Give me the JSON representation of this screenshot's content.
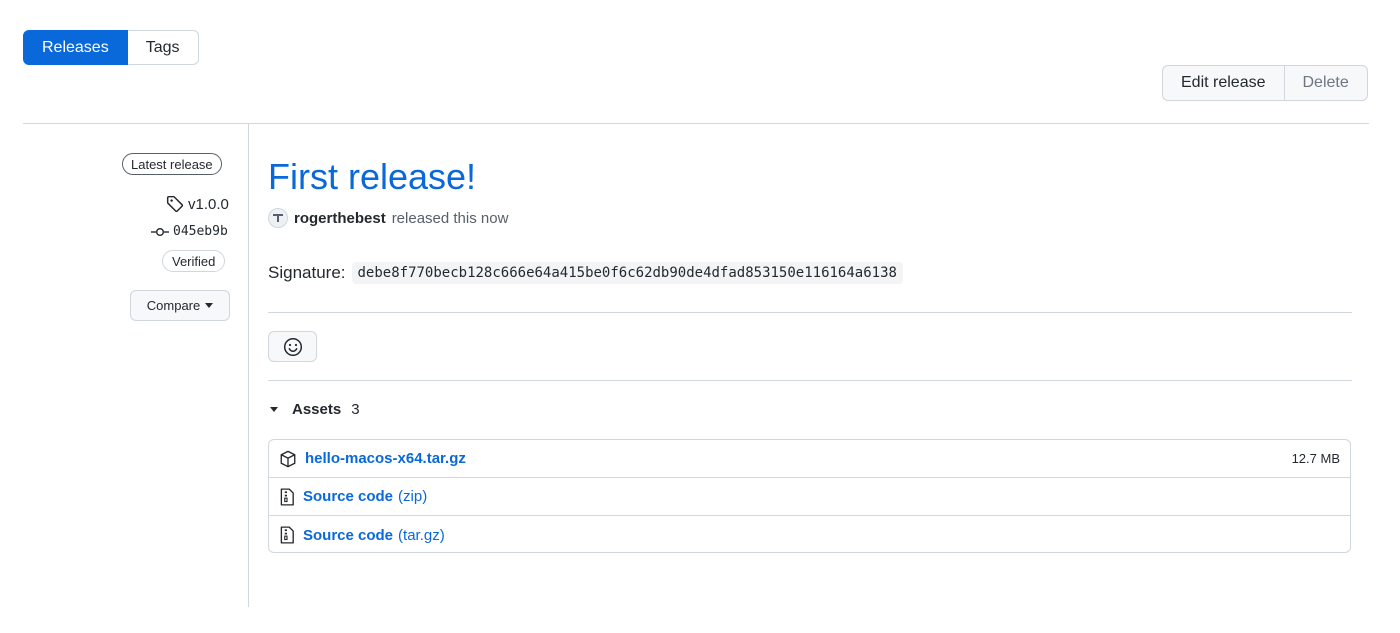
{
  "tabs": [
    {
      "label": "Releases",
      "active": true
    },
    {
      "label": "Tags",
      "active": false
    }
  ],
  "actions": {
    "edit_label": "Edit release",
    "delete_label": "Delete"
  },
  "sidebar": {
    "latest_badge": "Latest release",
    "tag": "v1.0.0",
    "commit": "045eb9b",
    "verified": "Verified",
    "compare_label": "Compare"
  },
  "release": {
    "title": "First release!",
    "author": "rogerthebest",
    "released_text": "released this now",
    "signature_label": "Signature:",
    "signature_value": "debe8f770becb128c666e64a415be0f6c62db90de4dfad853150e116164a6138"
  },
  "assets": {
    "label": "Assets",
    "count": "3",
    "items": [
      {
        "name": "hello-macos-x64.tar.gz",
        "sub": "",
        "size": "12.7 MB",
        "icon": "package-icon"
      },
      {
        "name": "Source code",
        "sub": "(zip)",
        "size": "",
        "icon": "file-zip-icon"
      },
      {
        "name": "Source code",
        "sub": "(tar.gz)",
        "size": "",
        "icon": "file-zip-icon"
      }
    ]
  },
  "colors": {
    "accent": "#0969da",
    "border": "#d0d7de",
    "text": "#24292f"
  }
}
